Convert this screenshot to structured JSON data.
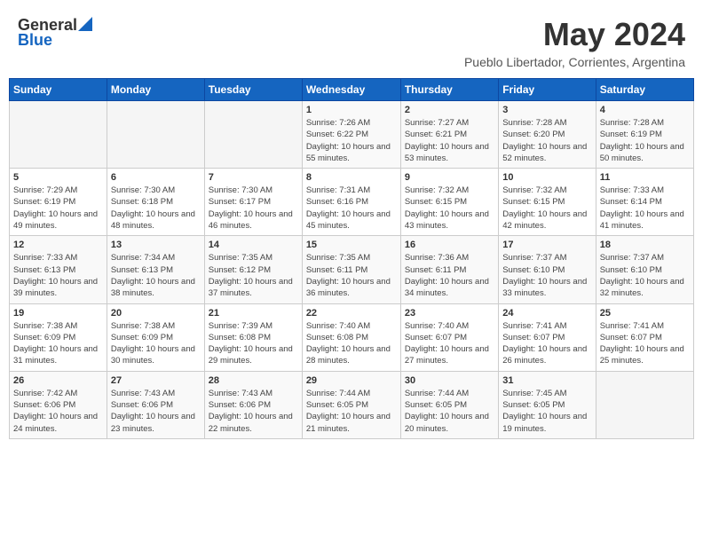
{
  "header": {
    "logo_general": "General",
    "logo_blue": "Blue",
    "month": "May 2024",
    "location": "Pueblo Libertador, Corrientes, Argentina"
  },
  "days_of_week": [
    "Sunday",
    "Monday",
    "Tuesday",
    "Wednesday",
    "Thursday",
    "Friday",
    "Saturday"
  ],
  "weeks": [
    [
      {
        "day": "",
        "sunrise": "",
        "sunset": "",
        "daylight": ""
      },
      {
        "day": "",
        "sunrise": "",
        "sunset": "",
        "daylight": ""
      },
      {
        "day": "",
        "sunrise": "",
        "sunset": "",
        "daylight": ""
      },
      {
        "day": "1",
        "sunrise": "Sunrise: 7:26 AM",
        "sunset": "Sunset: 6:22 PM",
        "daylight": "Daylight: 10 hours and 55 minutes."
      },
      {
        "day": "2",
        "sunrise": "Sunrise: 7:27 AM",
        "sunset": "Sunset: 6:21 PM",
        "daylight": "Daylight: 10 hours and 53 minutes."
      },
      {
        "day": "3",
        "sunrise": "Sunrise: 7:28 AM",
        "sunset": "Sunset: 6:20 PM",
        "daylight": "Daylight: 10 hours and 52 minutes."
      },
      {
        "day": "4",
        "sunrise": "Sunrise: 7:28 AM",
        "sunset": "Sunset: 6:19 PM",
        "daylight": "Daylight: 10 hours and 50 minutes."
      }
    ],
    [
      {
        "day": "5",
        "sunrise": "Sunrise: 7:29 AM",
        "sunset": "Sunset: 6:19 PM",
        "daylight": "Daylight: 10 hours and 49 minutes."
      },
      {
        "day": "6",
        "sunrise": "Sunrise: 7:30 AM",
        "sunset": "Sunset: 6:18 PM",
        "daylight": "Daylight: 10 hours and 48 minutes."
      },
      {
        "day": "7",
        "sunrise": "Sunrise: 7:30 AM",
        "sunset": "Sunset: 6:17 PM",
        "daylight": "Daylight: 10 hours and 46 minutes."
      },
      {
        "day": "8",
        "sunrise": "Sunrise: 7:31 AM",
        "sunset": "Sunset: 6:16 PM",
        "daylight": "Daylight: 10 hours and 45 minutes."
      },
      {
        "day": "9",
        "sunrise": "Sunrise: 7:32 AM",
        "sunset": "Sunset: 6:15 PM",
        "daylight": "Daylight: 10 hours and 43 minutes."
      },
      {
        "day": "10",
        "sunrise": "Sunrise: 7:32 AM",
        "sunset": "Sunset: 6:15 PM",
        "daylight": "Daylight: 10 hours and 42 minutes."
      },
      {
        "day": "11",
        "sunrise": "Sunrise: 7:33 AM",
        "sunset": "Sunset: 6:14 PM",
        "daylight": "Daylight: 10 hours and 41 minutes."
      }
    ],
    [
      {
        "day": "12",
        "sunrise": "Sunrise: 7:33 AM",
        "sunset": "Sunset: 6:13 PM",
        "daylight": "Daylight: 10 hours and 39 minutes."
      },
      {
        "day": "13",
        "sunrise": "Sunrise: 7:34 AM",
        "sunset": "Sunset: 6:13 PM",
        "daylight": "Daylight: 10 hours and 38 minutes."
      },
      {
        "day": "14",
        "sunrise": "Sunrise: 7:35 AM",
        "sunset": "Sunset: 6:12 PM",
        "daylight": "Daylight: 10 hours and 37 minutes."
      },
      {
        "day": "15",
        "sunrise": "Sunrise: 7:35 AM",
        "sunset": "Sunset: 6:11 PM",
        "daylight": "Daylight: 10 hours and 36 minutes."
      },
      {
        "day": "16",
        "sunrise": "Sunrise: 7:36 AM",
        "sunset": "Sunset: 6:11 PM",
        "daylight": "Daylight: 10 hours and 34 minutes."
      },
      {
        "day": "17",
        "sunrise": "Sunrise: 7:37 AM",
        "sunset": "Sunset: 6:10 PM",
        "daylight": "Daylight: 10 hours and 33 minutes."
      },
      {
        "day": "18",
        "sunrise": "Sunrise: 7:37 AM",
        "sunset": "Sunset: 6:10 PM",
        "daylight": "Daylight: 10 hours and 32 minutes."
      }
    ],
    [
      {
        "day": "19",
        "sunrise": "Sunrise: 7:38 AM",
        "sunset": "Sunset: 6:09 PM",
        "daylight": "Daylight: 10 hours and 31 minutes."
      },
      {
        "day": "20",
        "sunrise": "Sunrise: 7:38 AM",
        "sunset": "Sunset: 6:09 PM",
        "daylight": "Daylight: 10 hours and 30 minutes."
      },
      {
        "day": "21",
        "sunrise": "Sunrise: 7:39 AM",
        "sunset": "Sunset: 6:08 PM",
        "daylight": "Daylight: 10 hours and 29 minutes."
      },
      {
        "day": "22",
        "sunrise": "Sunrise: 7:40 AM",
        "sunset": "Sunset: 6:08 PM",
        "daylight": "Daylight: 10 hours and 28 minutes."
      },
      {
        "day": "23",
        "sunrise": "Sunrise: 7:40 AM",
        "sunset": "Sunset: 6:07 PM",
        "daylight": "Daylight: 10 hours and 27 minutes."
      },
      {
        "day": "24",
        "sunrise": "Sunrise: 7:41 AM",
        "sunset": "Sunset: 6:07 PM",
        "daylight": "Daylight: 10 hours and 26 minutes."
      },
      {
        "day": "25",
        "sunrise": "Sunrise: 7:41 AM",
        "sunset": "Sunset: 6:07 PM",
        "daylight": "Daylight: 10 hours and 25 minutes."
      }
    ],
    [
      {
        "day": "26",
        "sunrise": "Sunrise: 7:42 AM",
        "sunset": "Sunset: 6:06 PM",
        "daylight": "Daylight: 10 hours and 24 minutes."
      },
      {
        "day": "27",
        "sunrise": "Sunrise: 7:43 AM",
        "sunset": "Sunset: 6:06 PM",
        "daylight": "Daylight: 10 hours and 23 minutes."
      },
      {
        "day": "28",
        "sunrise": "Sunrise: 7:43 AM",
        "sunset": "Sunset: 6:06 PM",
        "daylight": "Daylight: 10 hours and 22 minutes."
      },
      {
        "day": "29",
        "sunrise": "Sunrise: 7:44 AM",
        "sunset": "Sunset: 6:05 PM",
        "daylight": "Daylight: 10 hours and 21 minutes."
      },
      {
        "day": "30",
        "sunrise": "Sunrise: 7:44 AM",
        "sunset": "Sunset: 6:05 PM",
        "daylight": "Daylight: 10 hours and 20 minutes."
      },
      {
        "day": "31",
        "sunrise": "Sunrise: 7:45 AM",
        "sunset": "Sunset: 6:05 PM",
        "daylight": "Daylight: 10 hours and 19 minutes."
      },
      {
        "day": "",
        "sunrise": "",
        "sunset": "",
        "daylight": ""
      }
    ]
  ]
}
